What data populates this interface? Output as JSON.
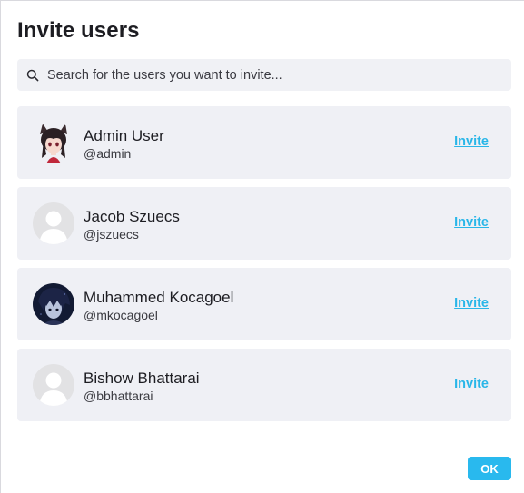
{
  "dialog": {
    "title": "Invite users",
    "search": {
      "placeholder": "Search for the users you want to invite...",
      "value": "",
      "icon": "search-icon"
    },
    "users": [
      {
        "name": "Admin User",
        "handle": "@admin",
        "action": "Invite",
        "avatar": "anime-character-avatar"
      },
      {
        "name": "Jacob Szuecs",
        "handle": "@jszuecs",
        "action": "Invite",
        "avatar": "default-person-avatar"
      },
      {
        "name": "Muhammed Kocagoel",
        "handle": "@mkocagoel",
        "action": "Invite",
        "avatar": "dark-anime-avatar"
      },
      {
        "name": "Bishow Bhattarai",
        "handle": "@bbhattarai",
        "action": "Invite",
        "avatar": "default-person-avatar"
      }
    ],
    "ok_label": "OK"
  },
  "colors": {
    "accent": "#29b6e8",
    "card_background": "#eff0f5",
    "search_background": "#f0f1f5"
  }
}
